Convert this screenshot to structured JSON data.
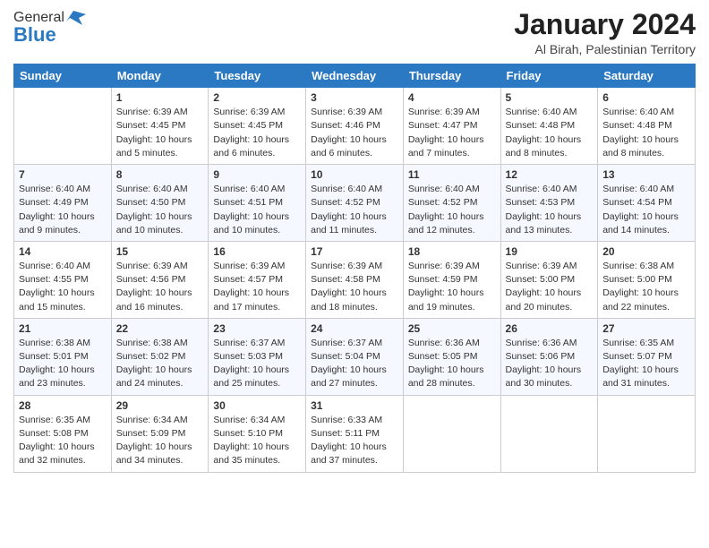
{
  "logo": {
    "general": "General",
    "blue": "Blue"
  },
  "title": "January 2024",
  "subtitle": "Al Birah, Palestinian Territory",
  "days_header": [
    "Sunday",
    "Monday",
    "Tuesday",
    "Wednesday",
    "Thursday",
    "Friday",
    "Saturday"
  ],
  "weeks": [
    [
      {
        "day": "",
        "sunrise": "",
        "sunset": "",
        "daylight": ""
      },
      {
        "day": "1",
        "sunrise": "Sunrise: 6:39 AM",
        "sunset": "Sunset: 4:45 PM",
        "daylight": "Daylight: 10 hours and 5 minutes."
      },
      {
        "day": "2",
        "sunrise": "Sunrise: 6:39 AM",
        "sunset": "Sunset: 4:45 PM",
        "daylight": "Daylight: 10 hours and 6 minutes."
      },
      {
        "day": "3",
        "sunrise": "Sunrise: 6:39 AM",
        "sunset": "Sunset: 4:46 PM",
        "daylight": "Daylight: 10 hours and 6 minutes."
      },
      {
        "day": "4",
        "sunrise": "Sunrise: 6:39 AM",
        "sunset": "Sunset: 4:47 PM",
        "daylight": "Daylight: 10 hours and 7 minutes."
      },
      {
        "day": "5",
        "sunrise": "Sunrise: 6:40 AM",
        "sunset": "Sunset: 4:48 PM",
        "daylight": "Daylight: 10 hours and 8 minutes."
      },
      {
        "day": "6",
        "sunrise": "Sunrise: 6:40 AM",
        "sunset": "Sunset: 4:48 PM",
        "daylight": "Daylight: 10 hours and 8 minutes."
      }
    ],
    [
      {
        "day": "7",
        "sunrise": "Sunrise: 6:40 AM",
        "sunset": "Sunset: 4:49 PM",
        "daylight": "Daylight: 10 hours and 9 minutes."
      },
      {
        "day": "8",
        "sunrise": "Sunrise: 6:40 AM",
        "sunset": "Sunset: 4:50 PM",
        "daylight": "Daylight: 10 hours and 10 minutes."
      },
      {
        "day": "9",
        "sunrise": "Sunrise: 6:40 AM",
        "sunset": "Sunset: 4:51 PM",
        "daylight": "Daylight: 10 hours and 10 minutes."
      },
      {
        "day": "10",
        "sunrise": "Sunrise: 6:40 AM",
        "sunset": "Sunset: 4:52 PM",
        "daylight": "Daylight: 10 hours and 11 minutes."
      },
      {
        "day": "11",
        "sunrise": "Sunrise: 6:40 AM",
        "sunset": "Sunset: 4:52 PM",
        "daylight": "Daylight: 10 hours and 12 minutes."
      },
      {
        "day": "12",
        "sunrise": "Sunrise: 6:40 AM",
        "sunset": "Sunset: 4:53 PM",
        "daylight": "Daylight: 10 hours and 13 minutes."
      },
      {
        "day": "13",
        "sunrise": "Sunrise: 6:40 AM",
        "sunset": "Sunset: 4:54 PM",
        "daylight": "Daylight: 10 hours and 14 minutes."
      }
    ],
    [
      {
        "day": "14",
        "sunrise": "Sunrise: 6:40 AM",
        "sunset": "Sunset: 4:55 PM",
        "daylight": "Daylight: 10 hours and 15 minutes."
      },
      {
        "day": "15",
        "sunrise": "Sunrise: 6:39 AM",
        "sunset": "Sunset: 4:56 PM",
        "daylight": "Daylight: 10 hours and 16 minutes."
      },
      {
        "day": "16",
        "sunrise": "Sunrise: 6:39 AM",
        "sunset": "Sunset: 4:57 PM",
        "daylight": "Daylight: 10 hours and 17 minutes."
      },
      {
        "day": "17",
        "sunrise": "Sunrise: 6:39 AM",
        "sunset": "Sunset: 4:58 PM",
        "daylight": "Daylight: 10 hours and 18 minutes."
      },
      {
        "day": "18",
        "sunrise": "Sunrise: 6:39 AM",
        "sunset": "Sunset: 4:59 PM",
        "daylight": "Daylight: 10 hours and 19 minutes."
      },
      {
        "day": "19",
        "sunrise": "Sunrise: 6:39 AM",
        "sunset": "Sunset: 5:00 PM",
        "daylight": "Daylight: 10 hours and 20 minutes."
      },
      {
        "day": "20",
        "sunrise": "Sunrise: 6:38 AM",
        "sunset": "Sunset: 5:00 PM",
        "daylight": "Daylight: 10 hours and 22 minutes."
      }
    ],
    [
      {
        "day": "21",
        "sunrise": "Sunrise: 6:38 AM",
        "sunset": "Sunset: 5:01 PM",
        "daylight": "Daylight: 10 hours and 23 minutes."
      },
      {
        "day": "22",
        "sunrise": "Sunrise: 6:38 AM",
        "sunset": "Sunset: 5:02 PM",
        "daylight": "Daylight: 10 hours and 24 minutes."
      },
      {
        "day": "23",
        "sunrise": "Sunrise: 6:37 AM",
        "sunset": "Sunset: 5:03 PM",
        "daylight": "Daylight: 10 hours and 25 minutes."
      },
      {
        "day": "24",
        "sunrise": "Sunrise: 6:37 AM",
        "sunset": "Sunset: 5:04 PM",
        "daylight": "Daylight: 10 hours and 27 minutes."
      },
      {
        "day": "25",
        "sunrise": "Sunrise: 6:36 AM",
        "sunset": "Sunset: 5:05 PM",
        "daylight": "Daylight: 10 hours and 28 minutes."
      },
      {
        "day": "26",
        "sunrise": "Sunrise: 6:36 AM",
        "sunset": "Sunset: 5:06 PM",
        "daylight": "Daylight: 10 hours and 30 minutes."
      },
      {
        "day": "27",
        "sunrise": "Sunrise: 6:35 AM",
        "sunset": "Sunset: 5:07 PM",
        "daylight": "Daylight: 10 hours and 31 minutes."
      }
    ],
    [
      {
        "day": "28",
        "sunrise": "Sunrise: 6:35 AM",
        "sunset": "Sunset: 5:08 PM",
        "daylight": "Daylight: 10 hours and 32 minutes."
      },
      {
        "day": "29",
        "sunrise": "Sunrise: 6:34 AM",
        "sunset": "Sunset: 5:09 PM",
        "daylight": "Daylight: 10 hours and 34 minutes."
      },
      {
        "day": "30",
        "sunrise": "Sunrise: 6:34 AM",
        "sunset": "Sunset: 5:10 PM",
        "daylight": "Daylight: 10 hours and 35 minutes."
      },
      {
        "day": "31",
        "sunrise": "Sunrise: 6:33 AM",
        "sunset": "Sunset: 5:11 PM",
        "daylight": "Daylight: 10 hours and 37 minutes."
      },
      {
        "day": "",
        "sunrise": "",
        "sunset": "",
        "daylight": ""
      },
      {
        "day": "",
        "sunrise": "",
        "sunset": "",
        "daylight": ""
      },
      {
        "day": "",
        "sunrise": "",
        "sunset": "",
        "daylight": ""
      }
    ]
  ]
}
